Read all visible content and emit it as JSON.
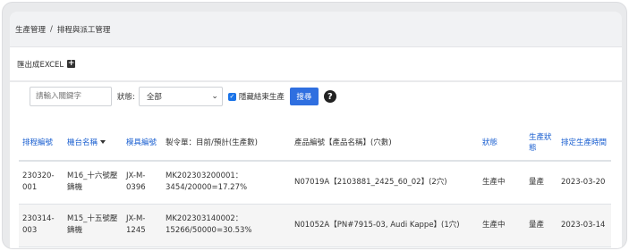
{
  "breadcrumb": {
    "parent": "生產管理",
    "separator": "/",
    "current": "排程與派工管理"
  },
  "toolbar": {
    "export_label": "匯出成EXCEL",
    "export_icon": "plus-square-icon"
  },
  "filters": {
    "search_placeholder": "請輸入關鍵字",
    "status_label": "狀態:",
    "status_value": "全部",
    "hide_finished_label": "隱藏結束生產",
    "hide_finished_checked": true,
    "query_label": "搜尋",
    "help_icon": "question-circle-icon"
  },
  "table": {
    "columns": {
      "schedule_no": "排程編號",
      "machine_name": "機台名稱",
      "mold_no": "模具編號",
      "order": "製令單：目前/預計(生產數)",
      "product": "產品編號【產品名稱】(穴數)",
      "status": "狀態",
      "production_status": "生產狀態",
      "scheduled_date": "排定生產時間"
    },
    "rows": [
      {
        "schedule_no": "230320-001",
        "machine_name": "M16_十六號壓鑄機",
        "mold_no": "JX-M-0396",
        "order": "MK202303200001：3454/20000=17.27%",
        "product": "N07019A【2103881_2425_60_02】(2穴)",
        "status": "生產中",
        "production_status": "量產",
        "scheduled_date": "2023-03-20"
      },
      {
        "schedule_no": "230314-003",
        "machine_name": "M15_十五號壓鑄機",
        "mold_no": "JX-M-1245",
        "order": "MK202303140002：15266/50000=30.53%",
        "product": "N01052A【PN#7915-03, Audi Kappe】(1穴)",
        "status": "生產中",
        "production_status": "量產",
        "scheduled_date": "2023-03-14"
      }
    ]
  }
}
